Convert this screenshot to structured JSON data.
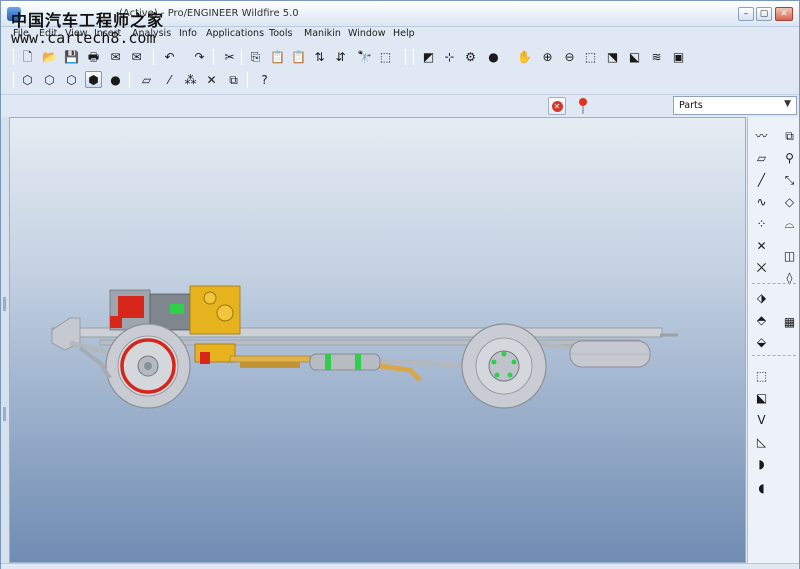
{
  "window": {
    "title": "(Active) - Pro/ENGINEER Wildfire 5.0",
    "watermark_text": "中国汽车工程师之家",
    "watermark_url": "www.cartech8.com"
  },
  "menu": [
    "File",
    "Edit",
    "View",
    "Insert",
    "Analysis",
    "Info",
    "Applications",
    "Tools",
    "Manikin",
    "Window",
    "Help"
  ],
  "toolbar_top": [
    {
      "icon": "new-icon",
      "glyph": "🗋"
    },
    {
      "icon": "open-icon",
      "glyph": "📂"
    },
    {
      "icon": "save-icon",
      "glyph": "💾"
    },
    {
      "icon": "print-icon",
      "glyph": "🖶"
    },
    {
      "icon": "email-icon",
      "glyph": "✉"
    },
    {
      "icon": "email-link-icon",
      "glyph": "✉"
    },
    {
      "icon": "undo-icon",
      "glyph": "↶"
    },
    {
      "icon": "redo-icon",
      "glyph": "↷"
    },
    {
      "icon": "cut-icon",
      "glyph": "✂"
    },
    {
      "icon": "copy-icon",
      "glyph": "⎘"
    },
    {
      "icon": "paste-icon",
      "glyph": "📋"
    },
    {
      "icon": "paste-special-icon",
      "glyph": "📋"
    },
    {
      "icon": "regenerate-icon",
      "glyph": "⇅"
    },
    {
      "icon": "regen-manager-icon",
      "glyph": "⇵"
    },
    {
      "icon": "find-icon",
      "glyph": "🔭"
    },
    {
      "icon": "select-box-icon",
      "glyph": "⬚"
    },
    {
      "icon": "repaint-icon",
      "glyph": "◩"
    },
    {
      "icon": "spin-center-icon",
      "glyph": "⊹"
    },
    {
      "icon": "orient-icon",
      "glyph": "⚙"
    },
    {
      "icon": "appearance-icon",
      "glyph": "●"
    },
    {
      "icon": "pan-icon",
      "glyph": "✋"
    },
    {
      "icon": "zoom-in-icon",
      "glyph": "⊕"
    },
    {
      "icon": "zoom-out-icon",
      "glyph": "⊖"
    },
    {
      "icon": "refit-icon",
      "glyph": "⬚"
    },
    {
      "icon": "reorient-icon",
      "glyph": "⬔"
    },
    {
      "icon": "saved-views-icon",
      "glyph": "⬕"
    },
    {
      "icon": "layers-icon",
      "glyph": "≋"
    },
    {
      "icon": "view-manager-icon",
      "glyph": "▣"
    }
  ],
  "toolbar_second": [
    {
      "icon": "wireframe-icon",
      "glyph": "⬡"
    },
    {
      "icon": "hidden-line-icon",
      "glyph": "⬡"
    },
    {
      "icon": "no-hidden-icon",
      "glyph": "⬡"
    },
    {
      "icon": "shading-icon",
      "glyph": "⬢",
      "active": true
    },
    {
      "icon": "enhanced-realism-icon",
      "glyph": "●"
    },
    {
      "icon": "plane-display-icon",
      "glyph": "▱"
    },
    {
      "icon": "axis-display-icon",
      "glyph": "⁄"
    },
    {
      "icon": "point-display-icon",
      "glyph": "⁂"
    },
    {
      "icon": "csys-display-icon",
      "glyph": "✕"
    },
    {
      "icon": "annotation-display-icon",
      "glyph": "⧉"
    },
    {
      "icon": "context-help-icon",
      "glyph": "?"
    }
  ],
  "status": {
    "filter_value": "Parts"
  },
  "right_toolbar": [
    {
      "icon": "sketch-icon",
      "glyph": "〰"
    },
    {
      "icon": "assemble-icon",
      "glyph": "⧉"
    },
    {
      "icon": "datum-plane-icon",
      "glyph": "▱"
    },
    {
      "icon": "create-component-icon",
      "glyph": "⚲"
    },
    {
      "icon": "datum-axis-icon",
      "glyph": "╱"
    },
    {
      "icon": "repeat-icon",
      "glyph": "⤡"
    },
    {
      "icon": "datum-curve-icon",
      "glyph": "∿"
    },
    {
      "icon": "package-icon",
      "glyph": "◇"
    },
    {
      "icon": "datum-point-icon",
      "glyph": "⁘"
    },
    {
      "icon": "mechanism-icon",
      "glyph": "⌓"
    },
    {
      "icon": "csys-icon",
      "glyph": "✕"
    },
    {
      "icon": "analysis-datum-icon",
      "glyph": "⨉"
    },
    {
      "icon": "mirror-component-icon",
      "glyph": "◫"
    },
    {
      "icon": "merge-icon",
      "glyph": "◊"
    },
    {
      "icon": "hole-icon",
      "glyph": "⬗"
    },
    {
      "icon": "pattern-icon",
      "glyph": "▦"
    },
    {
      "icon": "round-icon",
      "glyph": "⬘"
    },
    {
      "icon": "extrude-icon",
      "glyph": "⬙"
    },
    {
      "icon": "revolve-icon",
      "glyph": "⬚"
    },
    {
      "icon": "cut-feature-icon",
      "glyph": "⬕"
    },
    {
      "icon": "weld-icon",
      "glyph": "ⴸ"
    },
    {
      "icon": "chamfer-icon",
      "glyph": "◺"
    },
    {
      "icon": "draft-icon",
      "glyph": "◗"
    },
    {
      "icon": "shell-icon",
      "glyph": "◖"
    }
  ],
  "colors": {
    "chassis_frame": "#c8ccd2",
    "engine": "#e6b21d",
    "exhaust": "#d9a64a",
    "brake_red": "#d6261c",
    "highlight_green": "#2fcf4a",
    "tire": "#c9cdd3",
    "viewport_top": "#e6ecf3",
    "viewport_bottom": "#6f8cb3"
  }
}
